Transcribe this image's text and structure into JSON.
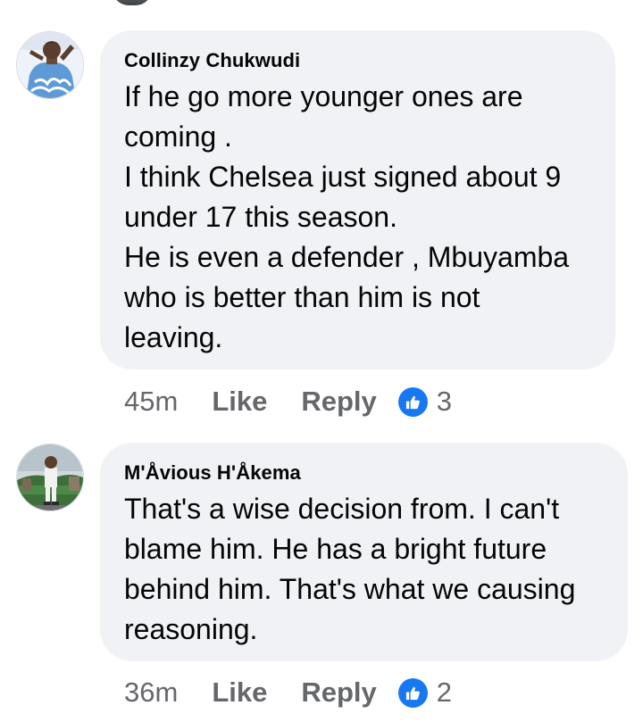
{
  "comments": [
    {
      "author": "Collinzy Chukwudi",
      "lines": [
        "If he go more younger ones are",
        "coming .",
        "I think Chelsea just signed about 9",
        "under 17 this season.",
        "He is even a defender , Mbuyamba",
        "who is better than him is not",
        "leaving."
      ],
      "time": "45m",
      "like_label": "Like",
      "reply_label": "Reply",
      "reaction_icon": "thumbs-up-icon",
      "reaction_count": "3"
    },
    {
      "author": "M'Åvious H'Åkema",
      "lines": [
        "That's a wise decision from. I can't",
        "blame him. He has a bright future",
        "behind him. That's what we causing",
        "reasoning."
      ],
      "time": "36m",
      "like_label": "Like",
      "reply_label": "Reply",
      "reaction_icon": "thumbs-up-icon",
      "reaction_count": "2"
    }
  ],
  "colors": {
    "bubble_bg": "#f0f2f5",
    "text": "#050505",
    "meta": "#65676b",
    "reaction_blue": "#1877f2"
  }
}
